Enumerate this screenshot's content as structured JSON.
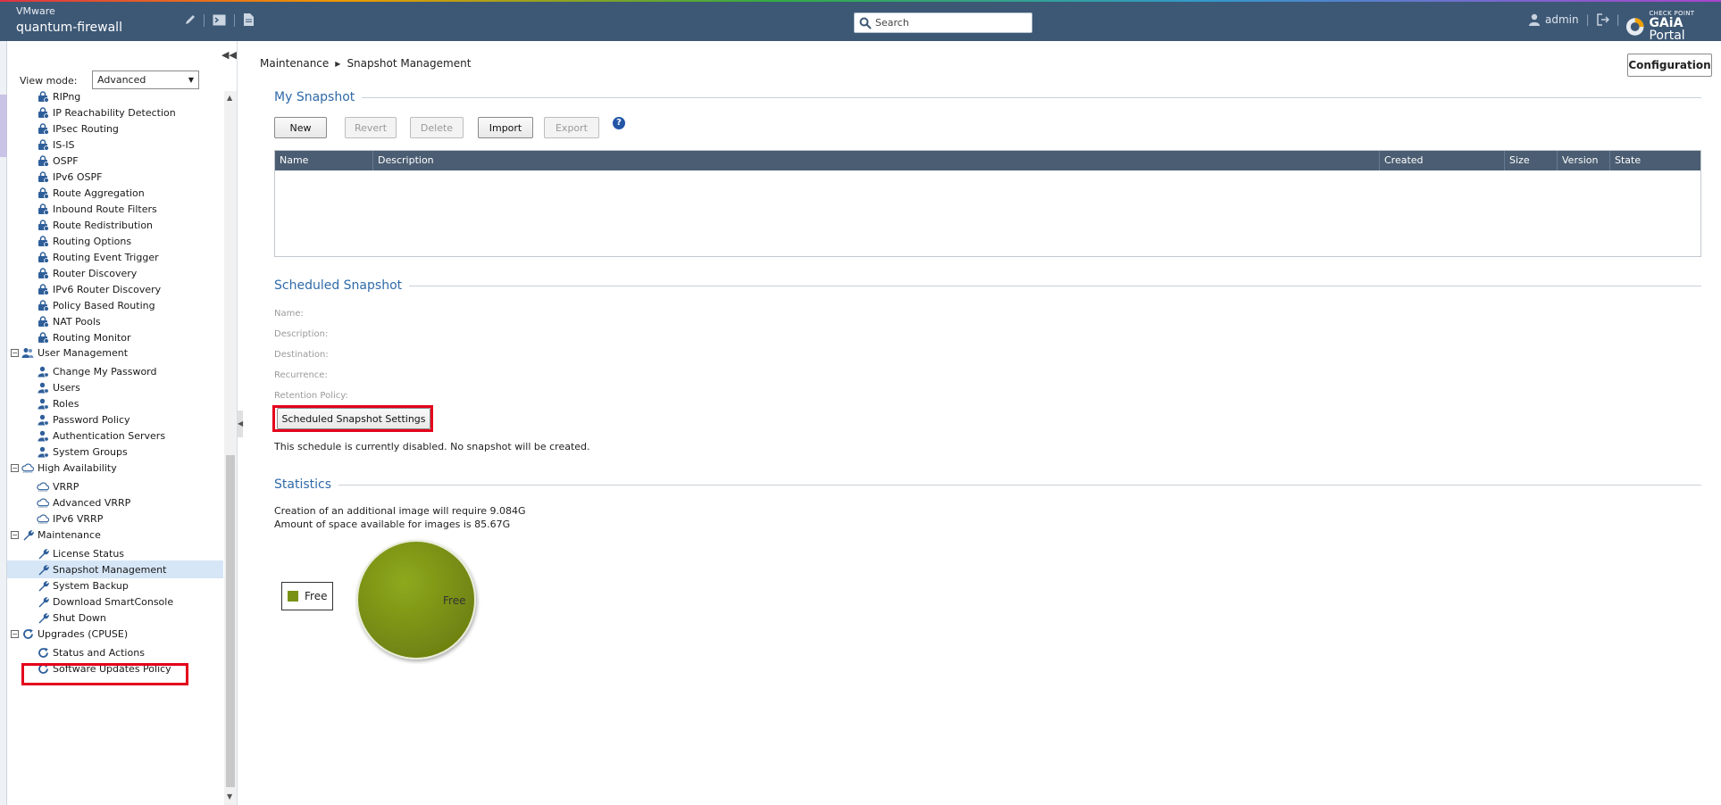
{
  "header": {
    "brand_top": "VMware",
    "hostname": "quantum-firewall",
    "icons": [
      "pencil-icon",
      "terminal-icon",
      "document-icon"
    ],
    "search": {
      "placeholder": "Search",
      "icon": "search-icon"
    },
    "user": {
      "name": "admin",
      "icon": "user-icon",
      "logout_icon": "logout-icon"
    },
    "logo": {
      "small": "CHECK POINT",
      "big_prefix": "GAiA",
      "big_suffix": " Portal"
    }
  },
  "nav": {
    "collapse_icon": "double-chevron-left-icon",
    "view_mode_label": "View mode:",
    "view_mode_value": "Advanced",
    "items": [
      {
        "label": "RIPng",
        "type": "child",
        "icon": "lock-icon"
      },
      {
        "label": "IP Reachability Detection",
        "type": "child",
        "icon": "lock-icon"
      },
      {
        "label": "IPsec Routing",
        "type": "child",
        "icon": "lock-icon"
      },
      {
        "label": "IS-IS",
        "type": "child",
        "icon": "lock-icon"
      },
      {
        "label": "OSPF",
        "type": "child",
        "icon": "lock-icon"
      },
      {
        "label": "IPv6 OSPF",
        "type": "child",
        "icon": "lock-icon"
      },
      {
        "label": "Route Aggregation",
        "type": "child",
        "icon": "lock-icon"
      },
      {
        "label": "Inbound Route Filters",
        "type": "child",
        "icon": "lock-icon"
      },
      {
        "label": "Route Redistribution",
        "type": "child",
        "icon": "lock-icon"
      },
      {
        "label": "Routing Options",
        "type": "child",
        "icon": "lock-icon"
      },
      {
        "label": "Routing Event Trigger",
        "type": "child",
        "icon": "lock-icon"
      },
      {
        "label": "Router Discovery",
        "type": "child",
        "icon": "lock-icon"
      },
      {
        "label": "IPv6 Router Discovery",
        "type": "child",
        "icon": "lock-icon"
      },
      {
        "label": "Policy Based Routing",
        "type": "child",
        "icon": "lock-icon"
      },
      {
        "label": "NAT Pools",
        "type": "child",
        "icon": "lock-icon"
      },
      {
        "label": "Routing Monitor",
        "type": "child",
        "icon": "lock-icon"
      },
      {
        "label": "User Management",
        "type": "group",
        "icon": "users-icon"
      },
      {
        "label": "Change My Password",
        "type": "child",
        "icon": "user-icon"
      },
      {
        "label": "Users",
        "type": "child",
        "icon": "user-icon"
      },
      {
        "label": "Roles",
        "type": "child",
        "icon": "user-icon"
      },
      {
        "label": "Password Policy",
        "type": "child",
        "icon": "user-icon"
      },
      {
        "label": "Authentication Servers",
        "type": "child",
        "icon": "user-icon"
      },
      {
        "label": "System Groups",
        "type": "child",
        "icon": "user-icon"
      },
      {
        "label": "High Availability",
        "type": "group",
        "icon": "cloud-icon"
      },
      {
        "label": "VRRP",
        "type": "child",
        "icon": "cloud-icon"
      },
      {
        "label": "Advanced VRRP",
        "type": "child",
        "icon": "cloud-icon"
      },
      {
        "label": "IPv6 VRRP",
        "type": "child",
        "icon": "cloud-icon"
      },
      {
        "label": "Maintenance",
        "type": "group",
        "icon": "wrench-icon"
      },
      {
        "label": "License Status",
        "type": "child",
        "icon": "wrench-icon"
      },
      {
        "label": "Snapshot Management",
        "type": "child",
        "icon": "wrench-icon",
        "selected": true
      },
      {
        "label": "System Backup",
        "type": "child",
        "icon": "wrench-icon"
      },
      {
        "label": "Download SmartConsole",
        "type": "child",
        "icon": "wrench-icon"
      },
      {
        "label": "Shut Down",
        "type": "child",
        "icon": "wrench-icon"
      },
      {
        "label": "Upgrades (CPUSE)",
        "type": "group",
        "icon": "refresh-icon"
      },
      {
        "label": "Status and Actions",
        "type": "child",
        "icon": "refresh-icon"
      },
      {
        "label": "Software Updates Policy",
        "type": "child",
        "icon": "refresh-icon"
      }
    ]
  },
  "main": {
    "breadcrumb": [
      "Maintenance",
      "Snapshot Management"
    ],
    "config_button": "Configuration",
    "my_snapshot": {
      "title": "My Snapshot",
      "buttons": [
        {
          "label": "New",
          "enabled": true
        },
        {
          "label": "Revert",
          "enabled": false
        },
        {
          "label": "Delete",
          "enabled": false
        },
        {
          "label": "Import",
          "enabled": true
        },
        {
          "label": "Export",
          "enabled": false
        }
      ],
      "help_icon": "help-icon",
      "columns": [
        "Name",
        "Description",
        "Created",
        "Size",
        "Version",
        "State"
      ],
      "rows": []
    },
    "scheduled": {
      "title": "Scheduled Snapshot",
      "fields": [
        "Name:",
        "Description:",
        "Destination:",
        "Recurrence:",
        "Retention Policy:"
      ],
      "settings_button": "Scheduled Snapshot Settings",
      "note": "This schedule is currently disabled. No snapshot will be created."
    },
    "statistics": {
      "title": "Statistics",
      "line1": "Creation of an additional image will require 9.084G",
      "line2": "Amount of space available for images is 85.67G",
      "legend_label": "Free",
      "pie_label": "Free",
      "pie_color": "#7a9216"
    }
  }
}
